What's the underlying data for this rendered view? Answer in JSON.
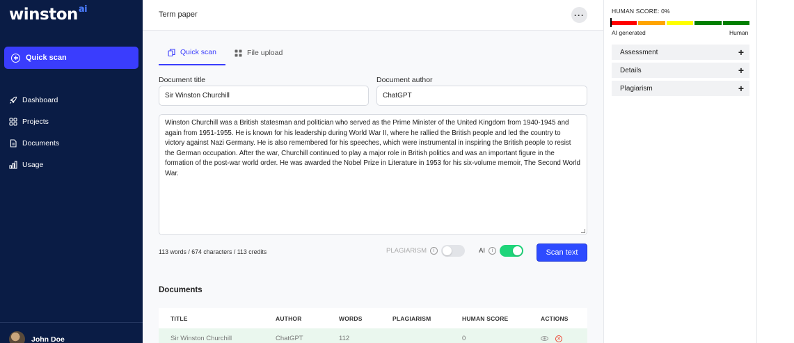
{
  "app": {
    "logo": "winston",
    "logo_suffix": "ai"
  },
  "sidebar": {
    "quick_scan_label": "Quick scan",
    "items": [
      {
        "label": "Dashboard",
        "icon": "rocket-icon"
      },
      {
        "label": "Projects",
        "icon": "grid-icon"
      },
      {
        "label": "Documents",
        "icon": "document-icon"
      },
      {
        "label": "Usage",
        "icon": "bar-chart-icon"
      }
    ],
    "user_name": "John Doe"
  },
  "header": {
    "title": "Term paper",
    "more_label": "···"
  },
  "tabs": [
    {
      "label": "Quick scan",
      "active": true
    },
    {
      "label": "File upload",
      "active": false
    }
  ],
  "form": {
    "title_label": "Document title",
    "title_value": "Sir Winston Churchill",
    "author_label": "Document author",
    "author_value": "ChatGPT",
    "body": "Winston Churchill was a British statesman and politician who served as the Prime Minister of the United Kingdom from 1940-1945 and again from 1951-1955. He is known for his leadership during World War II, where he rallied the British people and led the country to victory against Nazi Germany. He is also remembered for his speeches, which were instrumental in inspiring the British people to resist the German occupation. After the war, Churchill continued to play a major role in British politics and was an important figure in the formation of the post-war world order. He was awarded the Nobel Prize in Literature in 1953 for his six-volume memoir, The Second World War.",
    "counts": "113 words / 674 characters / 113 credits",
    "plagiarism_label": "PLAGIARISM",
    "plagiarism_on": false,
    "ai_label": "AI",
    "ai_on": true,
    "scan_button": "Scan text"
  },
  "documents": {
    "title": "Documents",
    "columns": [
      "TITLE",
      "AUTHOR",
      "WORDS",
      "PLAGIARISM",
      "HUMAN SCORE",
      "ACTIONS"
    ],
    "rows": [
      {
        "title": "Sir Winston Churchill",
        "author": "ChatGPT",
        "words": "112",
        "plagiarism": "",
        "human_score": "0"
      }
    ]
  },
  "score_panel": {
    "label": "HUMAN SCORE: 0%",
    "score": 0,
    "segments": [
      "#ff0000",
      "#ffa500",
      "#ffff00",
      "#008000",
      "#008000"
    ],
    "left_label": "AI generated",
    "right_label": "Human",
    "accordions": [
      "Assessment",
      "Details",
      "Plagiarism"
    ]
  }
}
